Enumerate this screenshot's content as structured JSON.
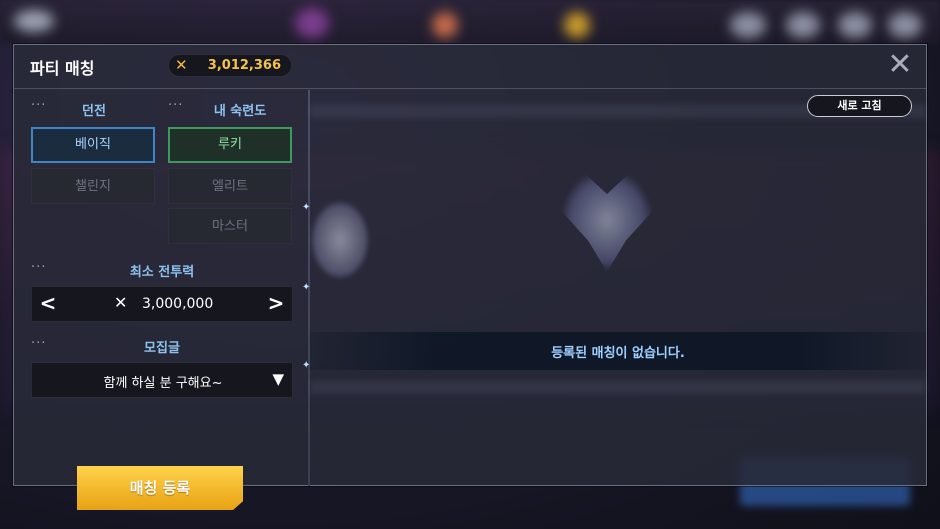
{
  "window": {
    "title": "파티 매칭",
    "currency": {
      "icon": "crossed-swords-icon",
      "value": "3,012,366",
      "color": "#f6c34a"
    },
    "close_icon": "close-icon"
  },
  "filters": {
    "dungeon": {
      "label": "던전",
      "options": [
        {
          "label": "베이직",
          "selected": true
        },
        {
          "label": "챌린지",
          "selected": false
        }
      ]
    },
    "proficiency": {
      "label": "내 숙련도",
      "options": [
        {
          "label": "루키",
          "selected": true
        },
        {
          "label": "엘리트",
          "selected": false
        },
        {
          "label": "마스터",
          "selected": false
        }
      ]
    },
    "min_power": {
      "label": "최소 전투력",
      "value": "3,000,000",
      "icon": "crossed-swords-icon"
    },
    "recruit_message": {
      "label": "모집글",
      "selected": "함께 하실 분 구해요~"
    }
  },
  "actions": {
    "register_label": "매칭 등록",
    "refresh_label": "새로 고침"
  },
  "results": {
    "empty_message": "등록된 매칭이 없습니다."
  },
  "colors": {
    "accent_blue": "#3f84c4",
    "accent_green": "#3d9a5b",
    "register_yellow": "#f2b91f",
    "label_blue": "#8fc3ef"
  }
}
